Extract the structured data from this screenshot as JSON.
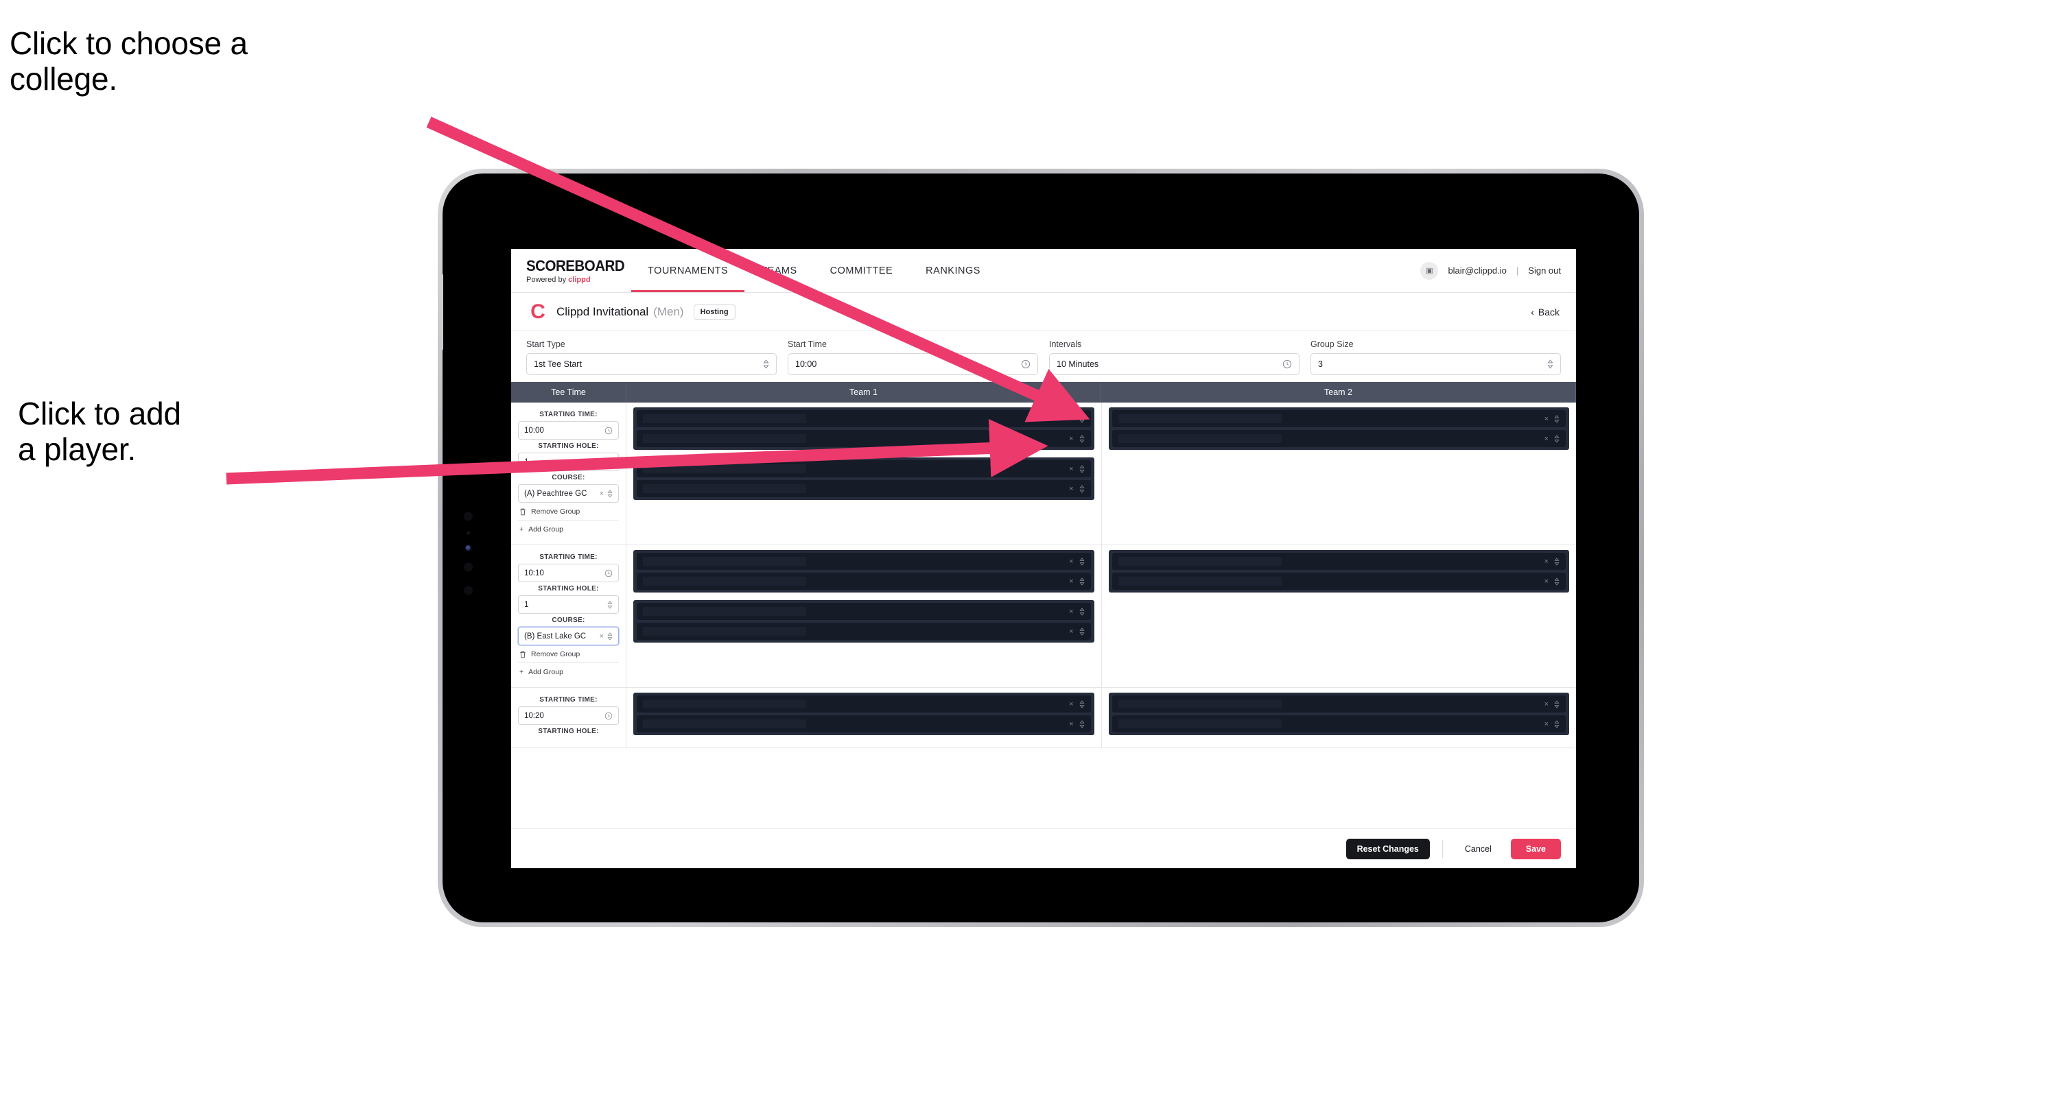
{
  "annotations": {
    "college": "Click to choose a\ncollege.",
    "player": "Click to add\na player."
  },
  "colors": {
    "accent": "#e8415f",
    "save": "#ea3c5e",
    "header_slate": "#4c5262",
    "group_box": "#262c3b",
    "player_row": "#161b28"
  },
  "app": {
    "logo": {
      "main": "SCOREBOARD",
      "sub_prefix": "Powered by ",
      "sub_brand": "clippd"
    },
    "nav_tabs": [
      {
        "label": "TOURNAMENTS",
        "active": true
      },
      {
        "label": "TEAMS",
        "active": false
      },
      {
        "label": "COMMITTEE",
        "active": false
      },
      {
        "label": "RANKINGS",
        "active": false
      }
    ],
    "account": {
      "avatar_glyph": "▣",
      "email": "blair@clippd.io",
      "separator": "|",
      "sign_out": "Sign out"
    },
    "title": {
      "brand_letter": "C",
      "name": "Clippd Invitational",
      "gender": "(Men)",
      "badge": "Hosting",
      "back": "Back",
      "back_chevron": "‹"
    },
    "controls": [
      {
        "label": "Start Type",
        "value": "1st Tee Start",
        "icon": "stepper-icon"
      },
      {
        "label": "Start Time",
        "value": "10:00",
        "icon": "clock-icon"
      },
      {
        "label": "Intervals",
        "value": "10 Minutes",
        "icon": "clock-icon"
      },
      {
        "label": "Group Size",
        "value": "3",
        "icon": "stepper-icon"
      }
    ],
    "table": {
      "headers": {
        "tee_time": "Tee Time",
        "team1": "Team 1",
        "team2": "Team 2"
      },
      "field_labels": {
        "starting_time": "STARTING TIME:",
        "starting_hole": "STARTING HOLE:",
        "course": "COURSE:"
      },
      "group_actions": {
        "remove": "Remove Group",
        "add": "Add Group"
      },
      "rows": [
        {
          "starting_time": "10:00",
          "starting_hole": "1",
          "course": "(A) Peachtree GC",
          "course_focused": false,
          "team1_groups": [
            {
              "players": 2
            },
            {
              "players": 2
            }
          ],
          "team2_groups": [
            {
              "players": 2
            }
          ]
        },
        {
          "starting_time": "10:10",
          "starting_hole": "1",
          "course": "(B) East Lake GC",
          "course_focused": true,
          "team1_groups": [
            {
              "players": 2
            },
            {
              "players": 2
            }
          ],
          "team2_groups": [
            {
              "players": 2
            }
          ]
        },
        {
          "starting_time": "10:20",
          "starting_hole": "",
          "course": "",
          "course_focused": false,
          "partial": true,
          "team1_groups": [
            {
              "players": 2
            }
          ],
          "team2_groups": [
            {
              "players": 2
            }
          ]
        }
      ]
    },
    "footer": {
      "reset": "Reset Changes",
      "cancel": "Cancel",
      "save": "Save"
    }
  }
}
